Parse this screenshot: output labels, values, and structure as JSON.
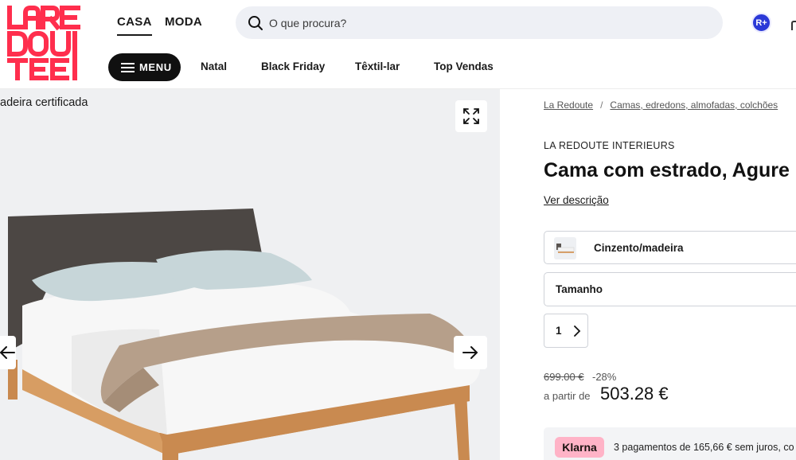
{
  "header": {
    "logo_text": "LA REDOUTE",
    "universes": [
      {
        "label": "CASA",
        "active": true
      },
      {
        "label": "MODA",
        "active": false
      }
    ],
    "search": {
      "placeholder": "O que procura?"
    },
    "rplus_label": "R+",
    "menu_label": "MENU",
    "nav_links": [
      "Natal",
      "Black Friday",
      "Têxtil-lar",
      "Top Vendas"
    ]
  },
  "gallery": {
    "badge_text": "adeira certificada"
  },
  "product": {
    "breadcrumb": [
      "La Redoute",
      "Camas, edredons, almofadas, colchões"
    ],
    "brand": "LA REDOUTE INTERIEURS",
    "title": "Cama com estrado, Agure",
    "description_link": "Ver descrição",
    "color_label": "Cinzento/madeira",
    "size_label": "Tamanho",
    "quantity": "1",
    "old_price": "699.00 €",
    "discount": "-28%",
    "price_prefix": "a partir de",
    "price": "503.28 €",
    "klarna": {
      "logo": "Klarna",
      "text": "3 pagamentos de 165,66 € sem juros, co"
    }
  },
  "colors": {
    "logo_red": "#ff2e4d",
    "menu_bg": "#101010",
    "search_bg": "#eef0f5",
    "rplus_blue": "#2b39d7",
    "klarna_pink": "#ffb3c7"
  }
}
